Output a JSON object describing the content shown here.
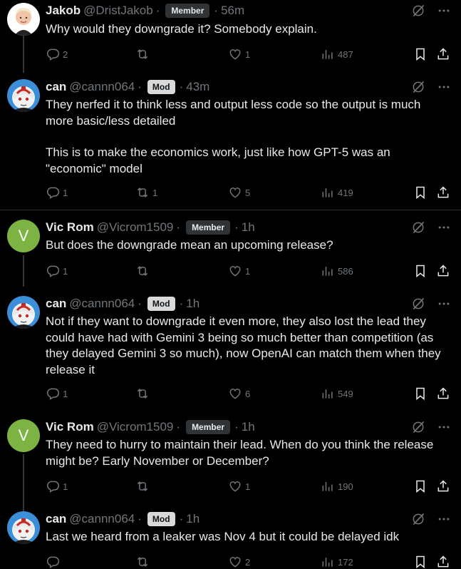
{
  "colors": {
    "background": "#000000",
    "text": "#e7e9ea",
    "muted": "#71767b",
    "divider": "#2f3336",
    "member_badge": "#2f3336",
    "mod_badge": "#d9d9d9",
    "avatar_v": "#7cb342"
  },
  "icons": [
    "reply-icon",
    "retweet-icon",
    "like-icon",
    "views-icon",
    "bookmark-icon",
    "share-icon",
    "grok-icon",
    "more-icon"
  ],
  "posts": [
    {
      "name": "Jakob",
      "handle": "@DristJakob",
      "badge": "Member",
      "time": "56m",
      "text": [
        "Why would they downgrade it? Somebody explain."
      ],
      "replies": "2",
      "reposts": "",
      "likes": "1",
      "views": "487"
    },
    {
      "name": "can",
      "handle": "@cannn064",
      "badge": "Mod",
      "time": "43m",
      "text": [
        "They nerfed it to think less and output less code so the output is much more basic/less detailed",
        "This is to make the economics work, just like how GPT-5 was an \"economic\" model"
      ],
      "replies": "1",
      "reposts": "1",
      "likes": "5",
      "views": "419"
    },
    {
      "name": "Vic Rom",
      "handle": "@Vicrom1509",
      "badge": "Member",
      "time": "1h",
      "avatar_letter": "V",
      "text": [
        "But does the downgrade mean an upcoming release?"
      ],
      "replies": "1",
      "reposts": "",
      "likes": "1",
      "views": "586"
    },
    {
      "name": "can",
      "handle": "@cannn064",
      "badge": "Mod",
      "time": "1h",
      "text": [
        "Not if they want to downgrade it even more, they also lost the lead they could have had with Gemini 3 being so much better than competition (as they delayed Gemini 3 so much), now OpenAI can match them when they release it"
      ],
      "replies": "1",
      "reposts": "",
      "likes": "6",
      "views": "549"
    },
    {
      "name": "Vic Rom",
      "handle": "@Vicrom1509",
      "badge": "Member",
      "time": "1h",
      "avatar_letter": "V",
      "text": [
        "They need to hurry to maintain their lead. When do you think the release might be? Early November or December?"
      ],
      "replies": "1",
      "reposts": "",
      "likes": "1",
      "views": "190"
    },
    {
      "name": "can",
      "handle": "@cannn064",
      "badge": "Mod",
      "time": "1h",
      "text": [
        "Last we heard from a leaker was Nov 4 but it could be delayed idk"
      ],
      "replies": "",
      "reposts": "",
      "likes": "2",
      "views": "172"
    }
  ]
}
